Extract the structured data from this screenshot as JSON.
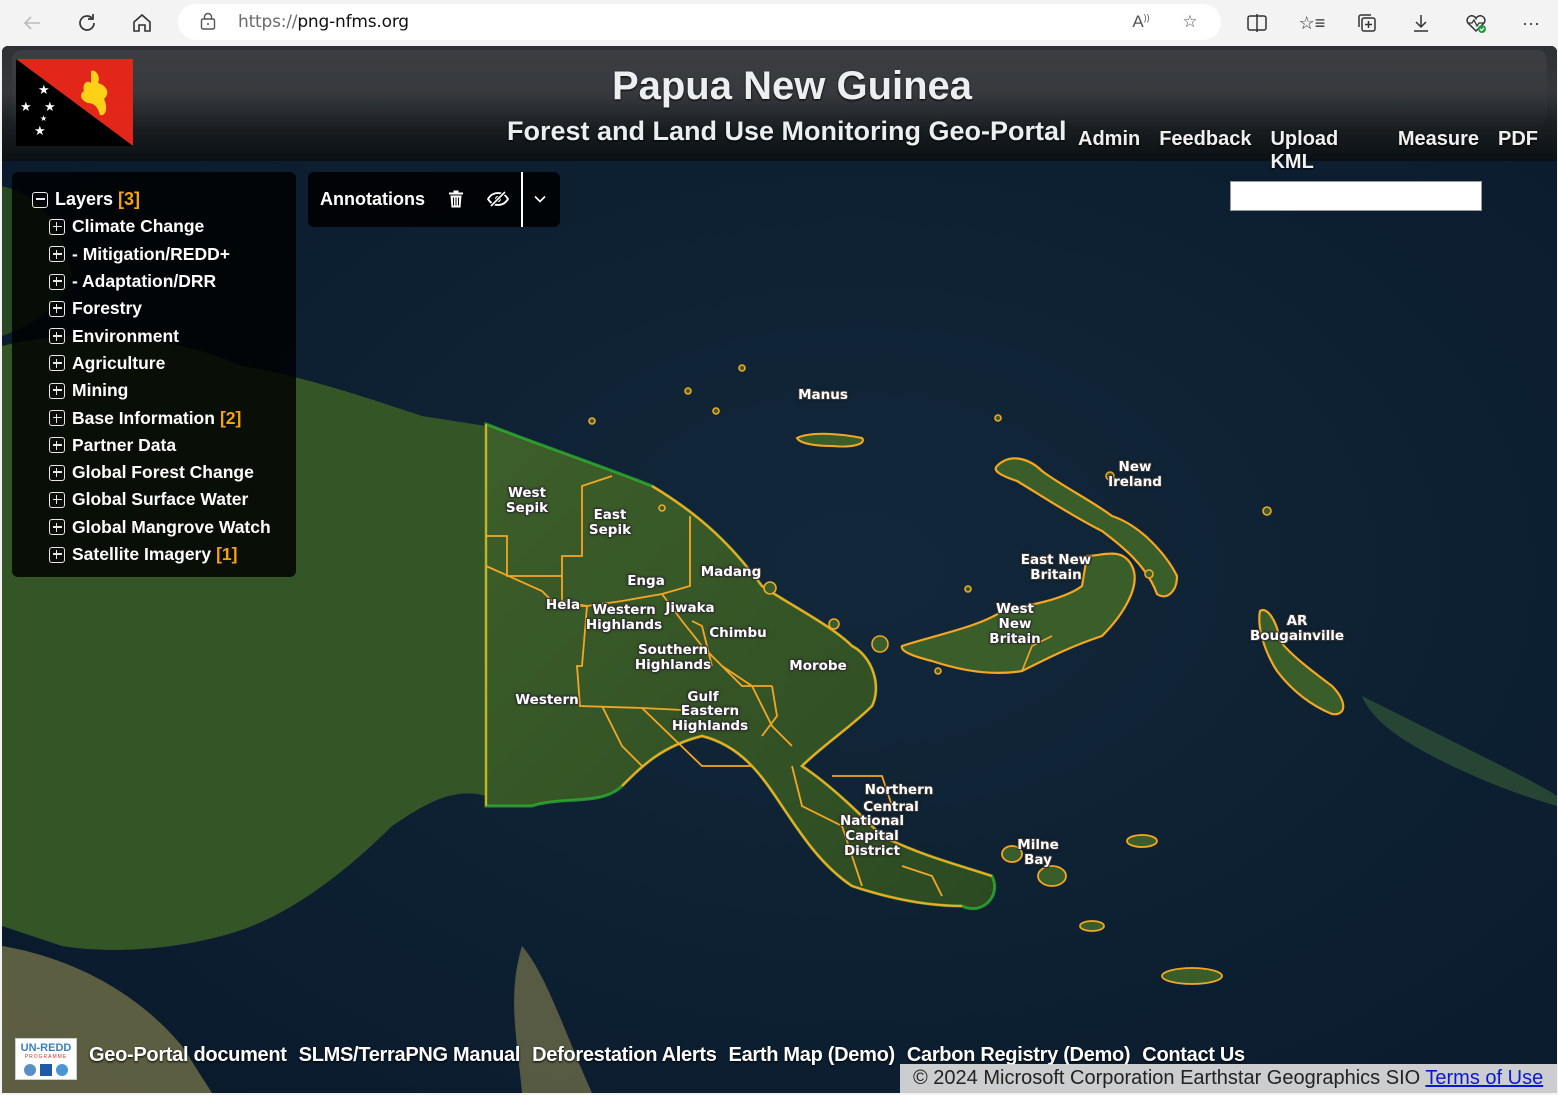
{
  "browser": {
    "url_protocol": "https://",
    "url_host": "png-nfms.org",
    "icons": [
      "back-icon",
      "refresh-icon",
      "home-icon",
      "lock-icon",
      "read-aloud-icon",
      "favorite-star-icon",
      "split-screen-icon",
      "favorites-list-icon",
      "collections-icon",
      "download-icon",
      "browser-essentials-icon",
      "more-icon"
    ]
  },
  "header": {
    "title": "Papua New Guinea",
    "subtitle": "Forest and Land Use Monitoring Geo-Portal",
    "links": [
      "Admin",
      "Feedback",
      "Upload KML",
      "Measure",
      "PDF"
    ]
  },
  "search": {
    "value": "",
    "placeholder": ""
  },
  "layers_panel": {
    "root_label": "Layers",
    "root_badge": "[3]",
    "items": [
      {
        "label": "Climate Change",
        "badge": ""
      },
      {
        "label": "- Mitigation/REDD+",
        "badge": ""
      },
      {
        "label": "- Adaptation/DRR",
        "badge": ""
      },
      {
        "label": "Forestry",
        "badge": ""
      },
      {
        "label": "Environment",
        "badge": ""
      },
      {
        "label": "Agriculture",
        "badge": ""
      },
      {
        "label": "Mining",
        "badge": ""
      },
      {
        "label": "Base Information",
        "badge": "[2]"
      },
      {
        "label": "Partner Data",
        "badge": ""
      },
      {
        "label": "Global Forest Change",
        "badge": ""
      },
      {
        "label": "Global Surface Water",
        "badge": ""
      },
      {
        "label": "Global Mangrove Watch",
        "badge": ""
      },
      {
        "label": "Satellite Imagery",
        "badge": "[1]"
      }
    ]
  },
  "annotations": {
    "label": "Annotations",
    "icons": [
      "trash-icon",
      "hide-eye-icon",
      "chevron-down-icon"
    ]
  },
  "map": {
    "boundary_color": "#f5a623",
    "coast_glow_color": "#2fbf2f",
    "province_labels": [
      {
        "id": "west-sepik",
        "text": "West\nSepik"
      },
      {
        "id": "east-sepik",
        "text": "East\nSepik"
      },
      {
        "id": "madang",
        "text": "Madang"
      },
      {
        "id": "enga",
        "text": "Enga"
      },
      {
        "id": "hela",
        "text": "Hela"
      },
      {
        "id": "western-highlands",
        "text": "Western\nHighlands"
      },
      {
        "id": "jiwaka",
        "text": "Jiwaka"
      },
      {
        "id": "chimbu",
        "text": "Chimbu"
      },
      {
        "id": "southern-highlands",
        "text": "Southern\nHighlands"
      },
      {
        "id": "morobe",
        "text": "Morobe"
      },
      {
        "id": "western",
        "text": "Western"
      },
      {
        "id": "gulf",
        "text": "Gulf"
      },
      {
        "id": "eastern-highlands",
        "text": "Eastern\nHighlands"
      },
      {
        "id": "northern",
        "text": "Northern"
      },
      {
        "id": "central",
        "text": "Central"
      },
      {
        "id": "ncd",
        "text": "National\nCapital\nDistrict"
      },
      {
        "id": "milne-bay",
        "text": "Milne\nBay"
      },
      {
        "id": "manus",
        "text": "Manus"
      },
      {
        "id": "new-ireland",
        "text": "New\nIreland"
      },
      {
        "id": "east-new-britain",
        "text": "East New\nBritain"
      },
      {
        "id": "west-new-britain",
        "text": "West\nNew\nBritain"
      },
      {
        "id": "ar-bougainville",
        "text": "AR\nBougainville"
      }
    ]
  },
  "footer": {
    "logo_text": "UN-REDD",
    "logo_subtext": "PROGRAMME",
    "links": [
      "Geo-Portal document",
      "SLMS/TerraPNG Manual",
      "Deforestation Alerts",
      "Earth Map (Demo)",
      "Carbon Registry (Demo)",
      "Contact Us"
    ],
    "attribution": "© 2024 Microsoft Corporation Earthstar Geographics SIO",
    "terms_link": "Terms of Use"
  }
}
